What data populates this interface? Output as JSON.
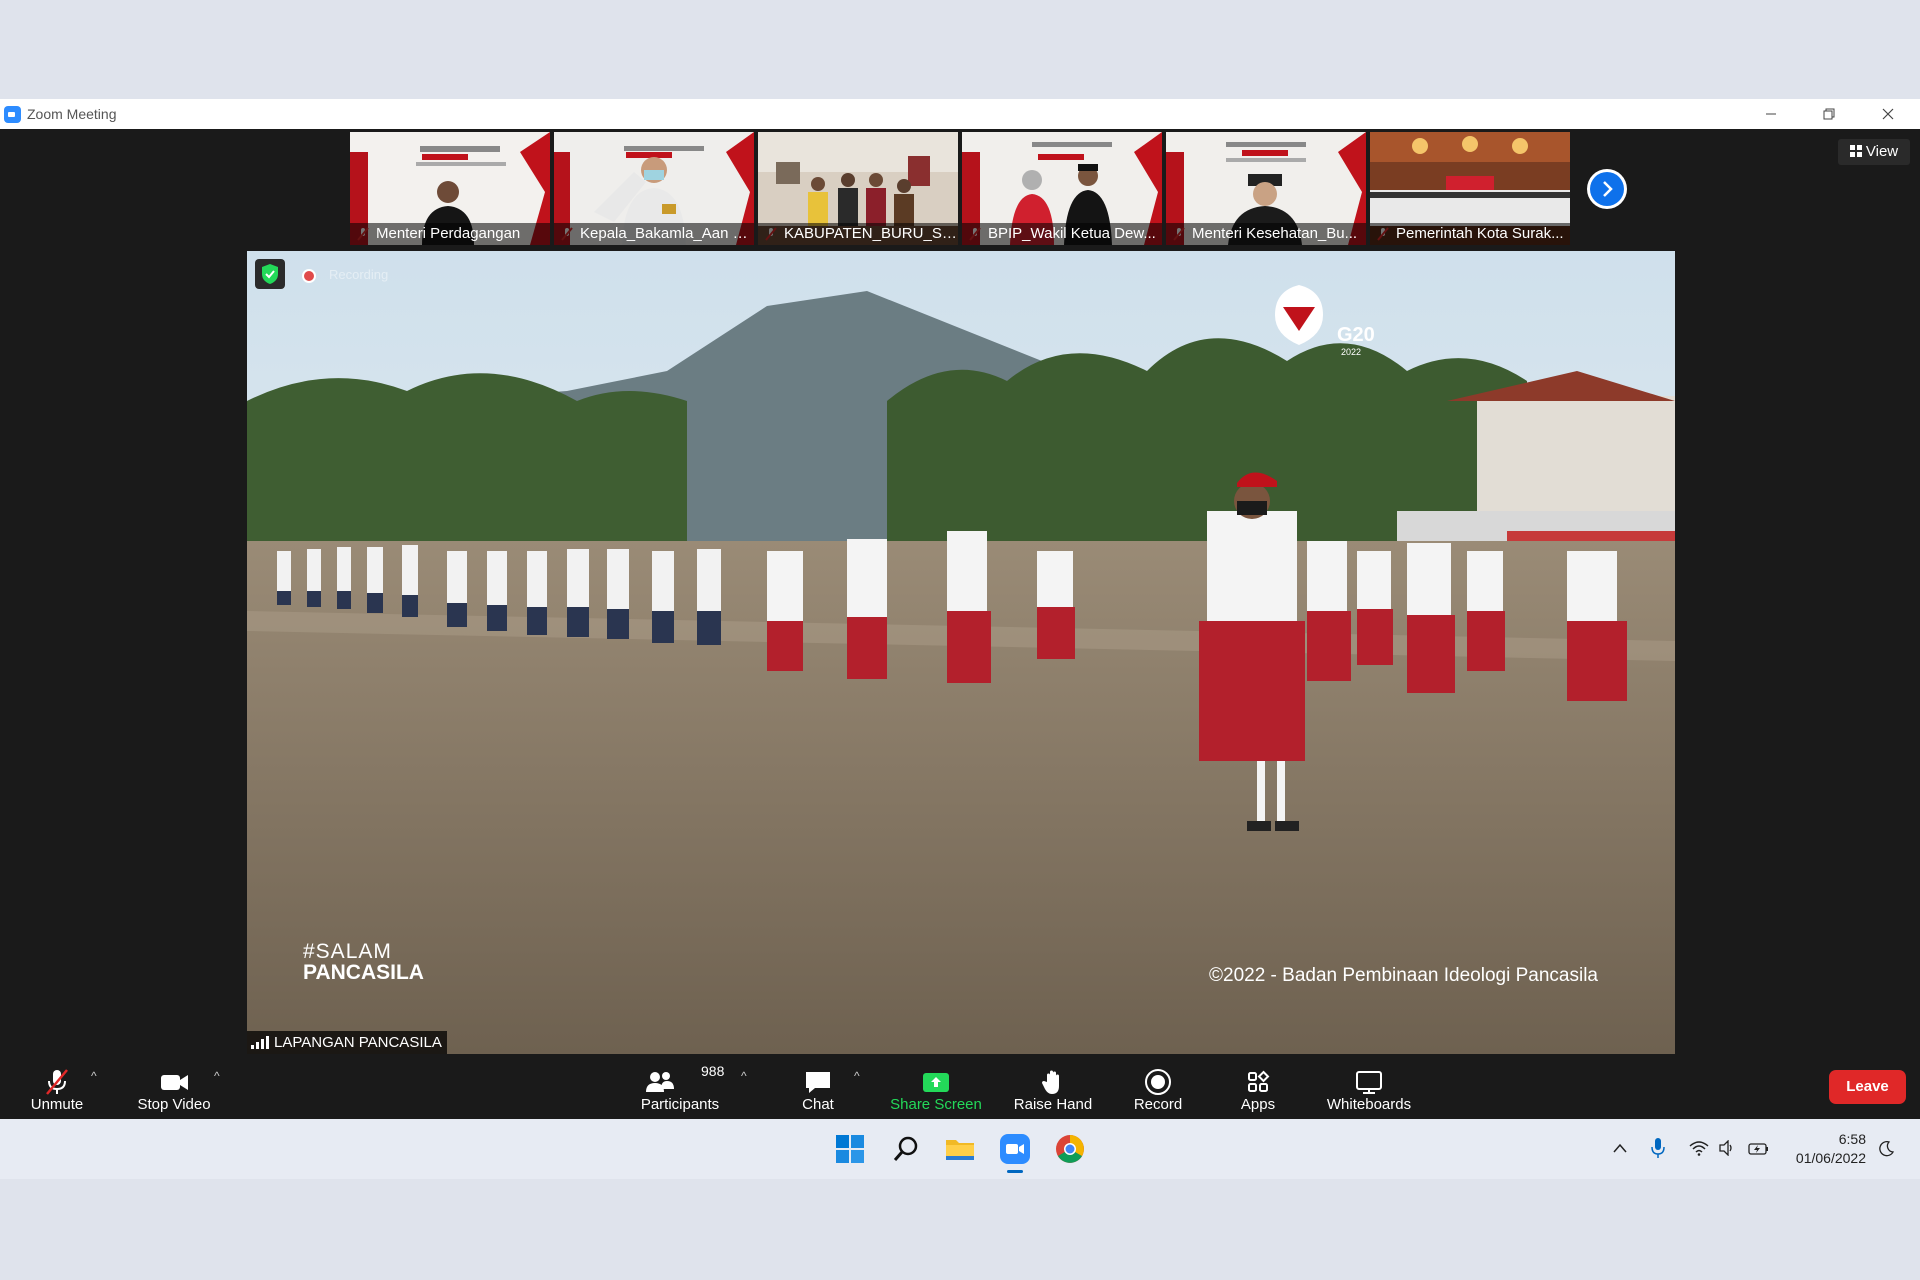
{
  "window": {
    "title": "Zoom Meeting",
    "minimize_icon": "minimize-icon",
    "restore_icon": "restore-icon",
    "close_icon": "close-icon"
  },
  "gallery": {
    "participants": [
      {
        "name": "Menteri Perdagangan"
      },
      {
        "name": "Kepala_Bakamla_Aan K..."
      },
      {
        "name": "KABUPATEN_BURU_SE..."
      },
      {
        "name": "BPIP_Wakil Ketua Dew..."
      },
      {
        "name": "Menteri Kesehatan_Bu..."
      },
      {
        "name": "Pemerintah Kota Surak..."
      }
    ],
    "view_label": "View"
  },
  "main_video": {
    "recording_label": "Recording",
    "hashtag_line1": "#SALAM",
    "hashtag_line2": "PANCASILA",
    "copyright": "©2022 - Badan Pembinaan Ideologi Pancasila",
    "speaker_name": "LAPANGAN PANCASILA",
    "logo_text": "G20",
    "logo_year": "2022"
  },
  "toolbar": {
    "unmute": "Unmute",
    "stop_video": "Stop Video",
    "participants": "Participants",
    "participants_count": "988",
    "chat": "Chat",
    "share_screen": "Share Screen",
    "raise_hand": "Raise Hand",
    "record": "Record",
    "apps": "Apps",
    "whiteboards": "Whiteboards",
    "leave": "Leave"
  },
  "taskbar": {
    "time": "6:58",
    "date": "01/06/2022"
  },
  "colors": {
    "share_green": "#23d959",
    "leave_red": "#e02828",
    "zoom_blue": "#0e71eb"
  }
}
